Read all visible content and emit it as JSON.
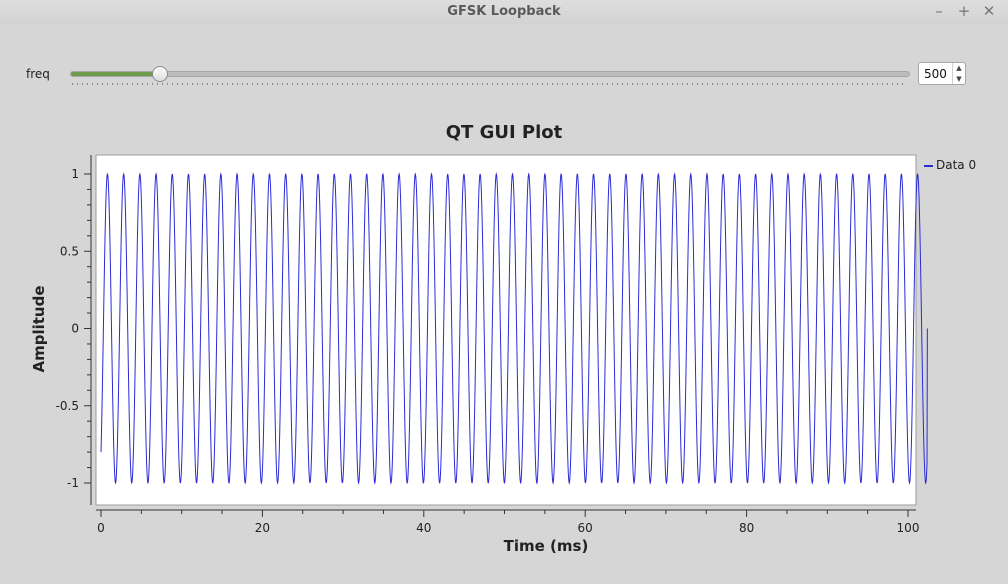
{
  "window": {
    "title": "GFSK Loopback",
    "controls": {
      "minimize": "–",
      "maximize": "+",
      "close": "✕"
    }
  },
  "controls": {
    "freq_label": "freq",
    "freq_value": "500",
    "slider_fraction": 0.107,
    "spin_up": "▲",
    "spin_down": "▼"
  },
  "colors": {
    "series": "#2b2bd6",
    "slider_fill": "#6e9c48",
    "plot_bg": "#ffffff"
  },
  "chart_data": {
    "type": "line",
    "title": "QT GUI Plot",
    "xlabel": "Time (ms)",
    "ylabel": "Amplitude",
    "xlim": [
      0,
      102.4
    ],
    "ylim": [
      -1.1,
      1.1
    ],
    "x_ticks": [
      0,
      20,
      40,
      60,
      80,
      100
    ],
    "x_tick_labels": [
      "0",
      "20",
      "40",
      "60",
      "80",
      "100"
    ],
    "y_ticks": [
      1,
      0.5,
      0,
      -0.5,
      -1
    ],
    "y_tick_labels": [
      "1",
      "0.5",
      "0",
      "-0.5",
      "-1"
    ],
    "series": [
      {
        "name": "Data 0",
        "function": "sine",
        "amplitude": 1,
        "frequency_hz": 500,
        "start_value": -0.8,
        "end_value": 0
      }
    ],
    "legend_position": "right",
    "grid": false
  }
}
